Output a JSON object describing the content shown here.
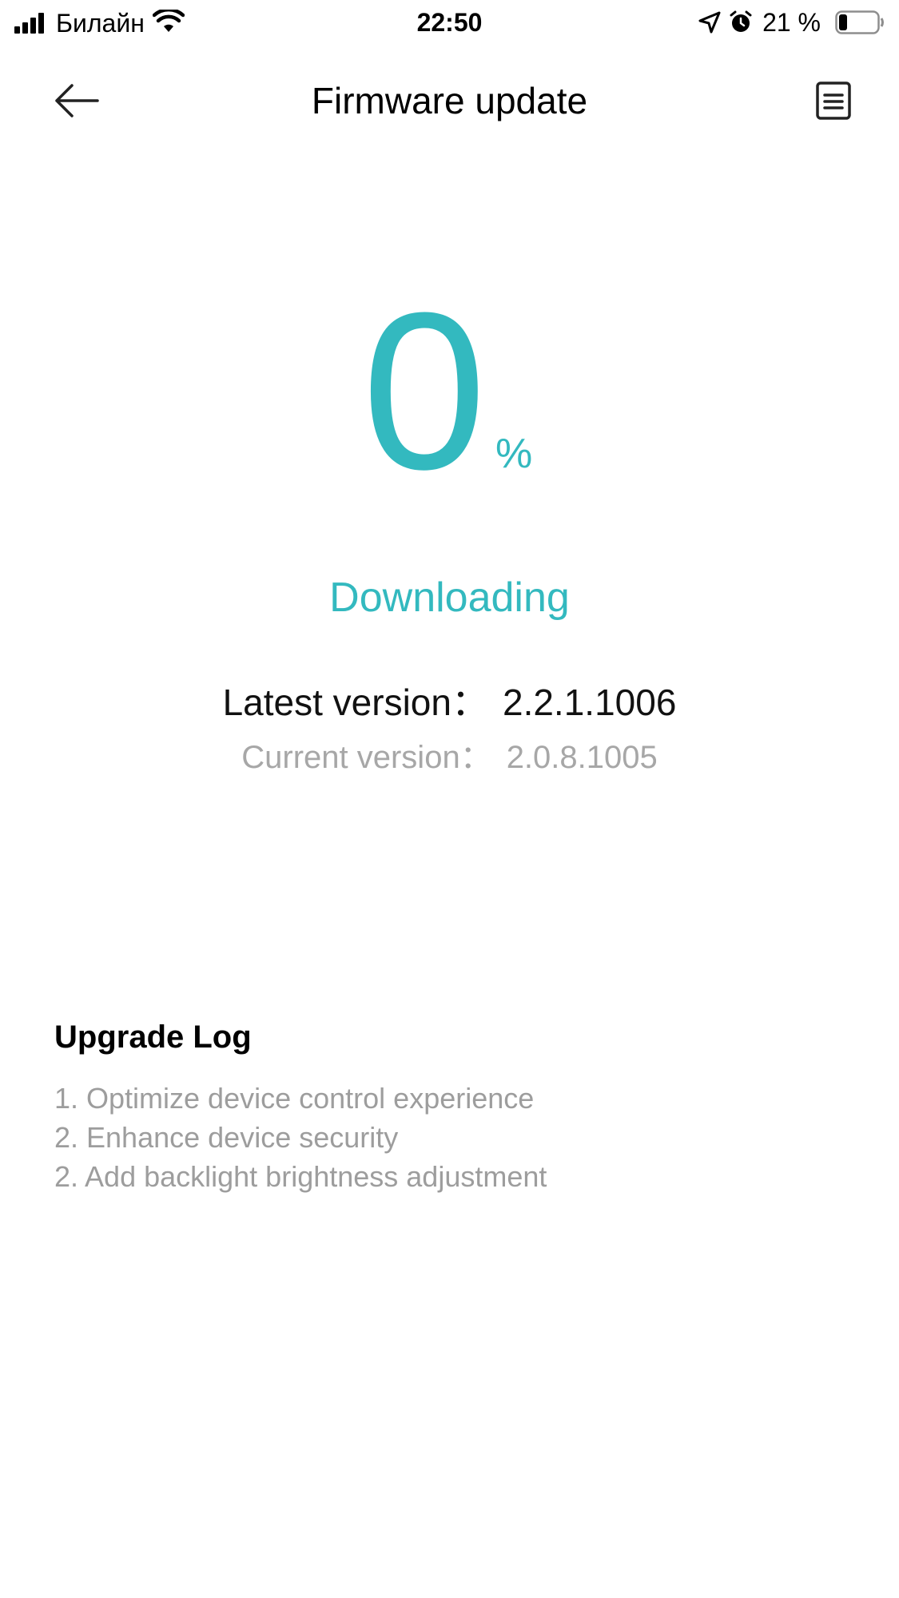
{
  "status_bar": {
    "carrier": "Билайн",
    "time": "22:50",
    "battery_percent": "21 %"
  },
  "nav": {
    "title": "Firmware update"
  },
  "progress": {
    "value": "0",
    "unit": "%",
    "status": "Downloading"
  },
  "versions": {
    "latest_label": "Latest version：",
    "latest_value": "2.2.1.1006",
    "current_label": "Current version：",
    "current_value": "2.0.8.1005"
  },
  "upgrade_log": {
    "title": "Upgrade Log",
    "items": [
      "1. Optimize device control experience",
      "2. Enhance device security",
      "2. Add backlight brightness adjustment"
    ]
  },
  "colors": {
    "accent": "#33b9bf",
    "muted_text": "#a7a7a7"
  },
  "icons": {
    "back": "arrow-left-icon",
    "log": "document-icon",
    "signal": "cellular-signal-icon",
    "wifi": "wifi-icon",
    "location": "location-arrow-icon",
    "alarm": "alarm-clock-icon",
    "battery": "battery-icon"
  }
}
